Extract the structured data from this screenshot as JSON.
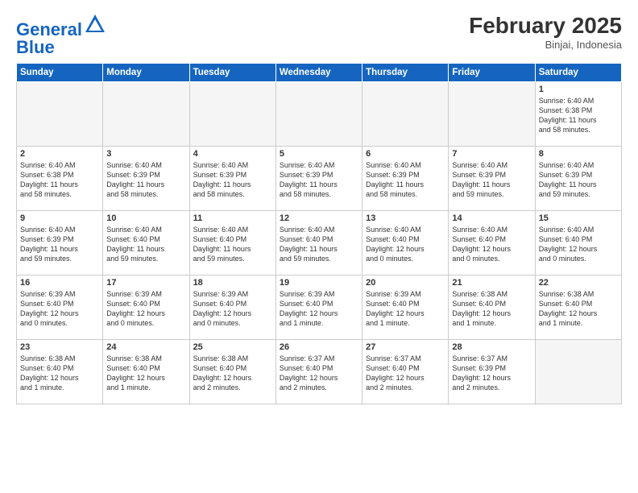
{
  "header": {
    "logo_general": "General",
    "logo_blue": "Blue",
    "month_year": "February 2025",
    "location": "Binjai, Indonesia"
  },
  "weekdays": [
    "Sunday",
    "Monday",
    "Tuesday",
    "Wednesday",
    "Thursday",
    "Friday",
    "Saturday"
  ],
  "weeks": [
    [
      {
        "day": "",
        "info": ""
      },
      {
        "day": "",
        "info": ""
      },
      {
        "day": "",
        "info": ""
      },
      {
        "day": "",
        "info": ""
      },
      {
        "day": "",
        "info": ""
      },
      {
        "day": "",
        "info": ""
      },
      {
        "day": "1",
        "info": "Sunrise: 6:40 AM\nSunset: 6:38 PM\nDaylight: 11 hours\nand 58 minutes."
      }
    ],
    [
      {
        "day": "2",
        "info": "Sunrise: 6:40 AM\nSunset: 6:38 PM\nDaylight: 11 hours\nand 58 minutes."
      },
      {
        "day": "3",
        "info": "Sunrise: 6:40 AM\nSunset: 6:39 PM\nDaylight: 11 hours\nand 58 minutes."
      },
      {
        "day": "4",
        "info": "Sunrise: 6:40 AM\nSunset: 6:39 PM\nDaylight: 11 hours\nand 58 minutes."
      },
      {
        "day": "5",
        "info": "Sunrise: 6:40 AM\nSunset: 6:39 PM\nDaylight: 11 hours\nand 58 minutes."
      },
      {
        "day": "6",
        "info": "Sunrise: 6:40 AM\nSunset: 6:39 PM\nDaylight: 11 hours\nand 58 minutes."
      },
      {
        "day": "7",
        "info": "Sunrise: 6:40 AM\nSunset: 6:39 PM\nDaylight: 11 hours\nand 59 minutes."
      },
      {
        "day": "8",
        "info": "Sunrise: 6:40 AM\nSunset: 6:39 PM\nDaylight: 11 hours\nand 59 minutes."
      }
    ],
    [
      {
        "day": "9",
        "info": "Sunrise: 6:40 AM\nSunset: 6:39 PM\nDaylight: 11 hours\nand 59 minutes."
      },
      {
        "day": "10",
        "info": "Sunrise: 6:40 AM\nSunset: 6:40 PM\nDaylight: 11 hours\nand 59 minutes."
      },
      {
        "day": "11",
        "info": "Sunrise: 6:40 AM\nSunset: 6:40 PM\nDaylight: 11 hours\nand 59 minutes."
      },
      {
        "day": "12",
        "info": "Sunrise: 6:40 AM\nSunset: 6:40 PM\nDaylight: 11 hours\nand 59 minutes."
      },
      {
        "day": "13",
        "info": "Sunrise: 6:40 AM\nSunset: 6:40 PM\nDaylight: 12 hours\nand 0 minutes."
      },
      {
        "day": "14",
        "info": "Sunrise: 6:40 AM\nSunset: 6:40 PM\nDaylight: 12 hours\nand 0 minutes."
      },
      {
        "day": "15",
        "info": "Sunrise: 6:40 AM\nSunset: 6:40 PM\nDaylight: 12 hours\nand 0 minutes."
      }
    ],
    [
      {
        "day": "16",
        "info": "Sunrise: 6:39 AM\nSunset: 6:40 PM\nDaylight: 12 hours\nand 0 minutes."
      },
      {
        "day": "17",
        "info": "Sunrise: 6:39 AM\nSunset: 6:40 PM\nDaylight: 12 hours\nand 0 minutes."
      },
      {
        "day": "18",
        "info": "Sunrise: 6:39 AM\nSunset: 6:40 PM\nDaylight: 12 hours\nand 0 minutes."
      },
      {
        "day": "19",
        "info": "Sunrise: 6:39 AM\nSunset: 6:40 PM\nDaylight: 12 hours\nand 1 minute."
      },
      {
        "day": "20",
        "info": "Sunrise: 6:39 AM\nSunset: 6:40 PM\nDaylight: 12 hours\nand 1 minute."
      },
      {
        "day": "21",
        "info": "Sunrise: 6:38 AM\nSunset: 6:40 PM\nDaylight: 12 hours\nand 1 minute."
      },
      {
        "day": "22",
        "info": "Sunrise: 6:38 AM\nSunset: 6:40 PM\nDaylight: 12 hours\nand 1 minute."
      }
    ],
    [
      {
        "day": "23",
        "info": "Sunrise: 6:38 AM\nSunset: 6:40 PM\nDaylight: 12 hours\nand 1 minute."
      },
      {
        "day": "24",
        "info": "Sunrise: 6:38 AM\nSunset: 6:40 PM\nDaylight: 12 hours\nand 1 minute."
      },
      {
        "day": "25",
        "info": "Sunrise: 6:38 AM\nSunset: 6:40 PM\nDaylight: 12 hours\nand 2 minutes."
      },
      {
        "day": "26",
        "info": "Sunrise: 6:37 AM\nSunset: 6:40 PM\nDaylight: 12 hours\nand 2 minutes."
      },
      {
        "day": "27",
        "info": "Sunrise: 6:37 AM\nSunset: 6:40 PM\nDaylight: 12 hours\nand 2 minutes."
      },
      {
        "day": "28",
        "info": "Sunrise: 6:37 AM\nSunset: 6:39 PM\nDaylight: 12 hours\nand 2 minutes."
      },
      {
        "day": "",
        "info": ""
      }
    ]
  ]
}
